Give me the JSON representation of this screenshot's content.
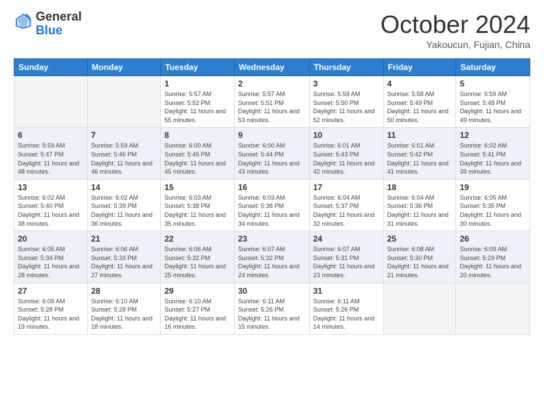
{
  "logo": {
    "general": "General",
    "blue": "Blue"
  },
  "header": {
    "month": "October 2024",
    "location": "Yakoucun, Fujian, China"
  },
  "days_of_week": [
    "Sunday",
    "Monday",
    "Tuesday",
    "Wednesday",
    "Thursday",
    "Friday",
    "Saturday"
  ],
  "weeks": [
    [
      null,
      null,
      {
        "day": "1",
        "sunrise": "Sunrise: 5:57 AM",
        "sunset": "Sunset: 5:52 PM",
        "daylight": "Daylight: 11 hours and 55 minutes."
      },
      {
        "day": "2",
        "sunrise": "Sunrise: 5:57 AM",
        "sunset": "Sunset: 5:51 PM",
        "daylight": "Daylight: 11 hours and 53 minutes."
      },
      {
        "day": "3",
        "sunrise": "Sunrise: 5:58 AM",
        "sunset": "Sunset: 5:50 PM",
        "daylight": "Daylight: 11 hours and 52 minutes."
      },
      {
        "day": "4",
        "sunrise": "Sunrise: 5:58 AM",
        "sunset": "Sunset: 5:49 PM",
        "daylight": "Daylight: 11 hours and 50 minutes."
      },
      {
        "day": "5",
        "sunrise": "Sunrise: 5:59 AM",
        "sunset": "Sunset: 5:48 PM",
        "daylight": "Daylight: 11 hours and 49 minutes."
      }
    ],
    [
      {
        "day": "6",
        "sunrise": "Sunrise: 5:59 AM",
        "sunset": "Sunset: 5:47 PM",
        "daylight": "Daylight: 11 hours and 48 minutes."
      },
      {
        "day": "7",
        "sunrise": "Sunrise: 5:59 AM",
        "sunset": "Sunset: 5:46 PM",
        "daylight": "Daylight: 11 hours and 46 minutes."
      },
      {
        "day": "8",
        "sunrise": "Sunrise: 6:00 AM",
        "sunset": "Sunset: 5:45 PM",
        "daylight": "Daylight: 11 hours and 45 minutes."
      },
      {
        "day": "9",
        "sunrise": "Sunrise: 6:00 AM",
        "sunset": "Sunset: 5:44 PM",
        "daylight": "Daylight: 11 hours and 43 minutes."
      },
      {
        "day": "10",
        "sunrise": "Sunrise: 6:01 AM",
        "sunset": "Sunset: 5:43 PM",
        "daylight": "Daylight: 11 hours and 42 minutes."
      },
      {
        "day": "11",
        "sunrise": "Sunrise: 6:01 AM",
        "sunset": "Sunset: 5:42 PM",
        "daylight": "Daylight: 11 hours and 41 minutes."
      },
      {
        "day": "12",
        "sunrise": "Sunrise: 6:02 AM",
        "sunset": "Sunset: 5:41 PM",
        "daylight": "Daylight: 11 hours and 39 minutes."
      }
    ],
    [
      {
        "day": "13",
        "sunrise": "Sunrise: 6:02 AM",
        "sunset": "Sunset: 5:40 PM",
        "daylight": "Daylight: 11 hours and 38 minutes."
      },
      {
        "day": "14",
        "sunrise": "Sunrise: 6:02 AM",
        "sunset": "Sunset: 5:39 PM",
        "daylight": "Daylight: 11 hours and 36 minutes."
      },
      {
        "day": "15",
        "sunrise": "Sunrise: 6:03 AM",
        "sunset": "Sunset: 5:38 PM",
        "daylight": "Daylight: 11 hours and 35 minutes."
      },
      {
        "day": "16",
        "sunrise": "Sunrise: 6:03 AM",
        "sunset": "Sunset: 5:38 PM",
        "daylight": "Daylight: 11 hours and 34 minutes."
      },
      {
        "day": "17",
        "sunrise": "Sunrise: 6:04 AM",
        "sunset": "Sunset: 5:37 PM",
        "daylight": "Daylight: 11 hours and 32 minutes."
      },
      {
        "day": "18",
        "sunrise": "Sunrise: 6:04 AM",
        "sunset": "Sunset: 5:36 PM",
        "daylight": "Daylight: 11 hours and 31 minutes."
      },
      {
        "day": "19",
        "sunrise": "Sunrise: 6:05 AM",
        "sunset": "Sunset: 5:35 PM",
        "daylight": "Daylight: 11 hours and 30 minutes."
      }
    ],
    [
      {
        "day": "20",
        "sunrise": "Sunrise: 6:05 AM",
        "sunset": "Sunset: 5:34 PM",
        "daylight": "Daylight: 11 hours and 28 minutes."
      },
      {
        "day": "21",
        "sunrise": "Sunrise: 6:06 AM",
        "sunset": "Sunset: 5:33 PM",
        "daylight": "Daylight: 11 hours and 27 minutes."
      },
      {
        "day": "22",
        "sunrise": "Sunrise: 6:06 AM",
        "sunset": "Sunset: 5:32 PM",
        "daylight": "Daylight: 11 hours and 25 minutes."
      },
      {
        "day": "23",
        "sunrise": "Sunrise: 6:07 AM",
        "sunset": "Sunset: 5:32 PM",
        "daylight": "Daylight: 11 hours and 24 minutes."
      },
      {
        "day": "24",
        "sunrise": "Sunrise: 6:07 AM",
        "sunset": "Sunset: 5:31 PM",
        "daylight": "Daylight: 11 hours and 23 minutes."
      },
      {
        "day": "25",
        "sunrise": "Sunrise: 6:08 AM",
        "sunset": "Sunset: 5:30 PM",
        "daylight": "Daylight: 11 hours and 21 minutes."
      },
      {
        "day": "26",
        "sunrise": "Sunrise: 6:09 AM",
        "sunset": "Sunset: 5:29 PM",
        "daylight": "Daylight: 11 hours and 20 minutes."
      }
    ],
    [
      {
        "day": "27",
        "sunrise": "Sunrise: 6:09 AM",
        "sunset": "Sunset: 5:28 PM",
        "daylight": "Daylight: 11 hours and 19 minutes."
      },
      {
        "day": "28",
        "sunrise": "Sunrise: 6:10 AM",
        "sunset": "Sunset: 5:28 PM",
        "daylight": "Daylight: 11 hours and 18 minutes."
      },
      {
        "day": "29",
        "sunrise": "Sunrise: 6:10 AM",
        "sunset": "Sunset: 5:27 PM",
        "daylight": "Daylight: 11 hours and 16 minutes."
      },
      {
        "day": "30",
        "sunrise": "Sunrise: 6:11 AM",
        "sunset": "Sunset: 5:26 PM",
        "daylight": "Daylight: 11 hours and 15 minutes."
      },
      {
        "day": "31",
        "sunrise": "Sunrise: 6:11 AM",
        "sunset": "Sunset: 5:26 PM",
        "daylight": "Daylight: 11 hours and 14 minutes."
      },
      null,
      null
    ]
  ]
}
